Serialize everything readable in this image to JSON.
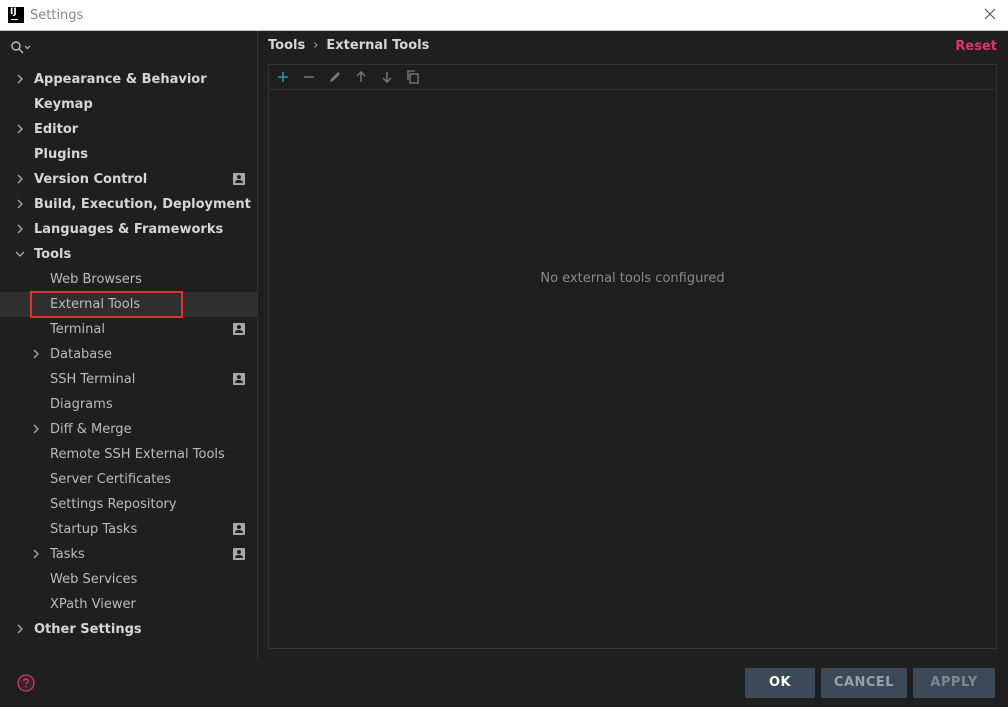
{
  "window": {
    "title": "Settings",
    "app_icon_text": "IJ"
  },
  "sidebar": {
    "items": [
      {
        "label": "Appearance & Behavior",
        "level": 0,
        "expandable": true,
        "expanded": false,
        "project_icon": false
      },
      {
        "label": "Keymap",
        "level": 0,
        "expandable": false,
        "expanded": false,
        "project_icon": false
      },
      {
        "label": "Editor",
        "level": 0,
        "expandable": true,
        "expanded": false,
        "project_icon": false
      },
      {
        "label": "Plugins",
        "level": 0,
        "expandable": false,
        "expanded": false,
        "project_icon": false
      },
      {
        "label": "Version Control",
        "level": 0,
        "expandable": true,
        "expanded": false,
        "project_icon": true
      },
      {
        "label": "Build, Execution, Deployment",
        "level": 0,
        "expandable": true,
        "expanded": false,
        "project_icon": false
      },
      {
        "label": "Languages & Frameworks",
        "level": 0,
        "expandable": true,
        "expanded": false,
        "project_icon": false
      },
      {
        "label": "Tools",
        "level": 0,
        "expandable": true,
        "expanded": true,
        "project_icon": false
      },
      {
        "label": "Web Browsers",
        "level": 1,
        "expandable": false,
        "expanded": false,
        "project_icon": false
      },
      {
        "label": "External Tools",
        "level": 1,
        "expandable": false,
        "expanded": false,
        "project_icon": false,
        "selected": true
      },
      {
        "label": "Terminal",
        "level": 1,
        "expandable": false,
        "expanded": false,
        "project_icon": true
      },
      {
        "label": "Database",
        "level": 1,
        "expandable": true,
        "expanded": false,
        "project_icon": false
      },
      {
        "label": "SSH Terminal",
        "level": 1,
        "expandable": false,
        "expanded": false,
        "project_icon": true
      },
      {
        "label": "Diagrams",
        "level": 1,
        "expandable": false,
        "expanded": false,
        "project_icon": false
      },
      {
        "label": "Diff & Merge",
        "level": 1,
        "expandable": true,
        "expanded": false,
        "project_icon": false
      },
      {
        "label": "Remote SSH External Tools",
        "level": 1,
        "expandable": false,
        "expanded": false,
        "project_icon": false
      },
      {
        "label": "Server Certificates",
        "level": 1,
        "expandable": false,
        "expanded": false,
        "project_icon": false
      },
      {
        "label": "Settings Repository",
        "level": 1,
        "expandable": false,
        "expanded": false,
        "project_icon": false
      },
      {
        "label": "Startup Tasks",
        "level": 1,
        "expandable": false,
        "expanded": false,
        "project_icon": true
      },
      {
        "label": "Tasks",
        "level": 1,
        "expandable": true,
        "expanded": false,
        "project_icon": true
      },
      {
        "label": "Web Services",
        "level": 1,
        "expandable": false,
        "expanded": false,
        "project_icon": false
      },
      {
        "label": "XPath Viewer",
        "level": 1,
        "expandable": false,
        "expanded": false,
        "project_icon": false
      },
      {
        "label": "Other Settings",
        "level": 0,
        "expandable": true,
        "expanded": false,
        "project_icon": false
      }
    ]
  },
  "main": {
    "breadcrumb": [
      "Tools",
      "External Tools"
    ],
    "reset_label": "Reset",
    "toolbar_icons": [
      "add-icon",
      "remove-icon",
      "edit-icon",
      "move-up-icon",
      "move-down-icon",
      "copy-icon"
    ],
    "empty_text": "No external tools configured"
  },
  "footer": {
    "ok_label": "OK",
    "cancel_label": "CANCEL",
    "apply_label": "APPLY"
  },
  "colors": {
    "background": "#1f1f1f",
    "accent_reset": "#e0336b",
    "add_icon": "#3592c4",
    "highlight_box": "#e03030",
    "button_bg": "#3b4a56"
  }
}
